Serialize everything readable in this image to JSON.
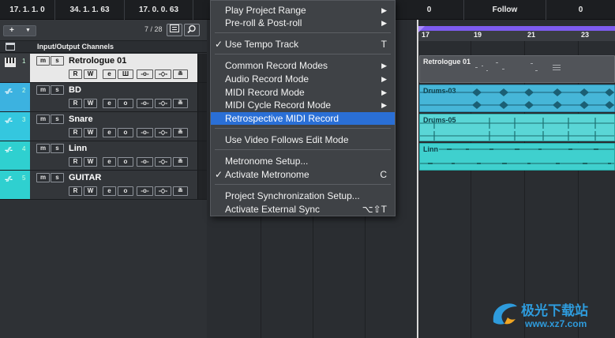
{
  "transport": {
    "cells": [
      "17. 1. 1.   0",
      "34. 1. 1. 63",
      "17. 0. 0. 63",
      "0",
      "Follow",
      "0"
    ]
  },
  "tracklist": {
    "add_label": "+",
    "count": "7 / 28",
    "io_label": "Input/Output Channels",
    "tracks": [
      {
        "num": "1",
        "name": "Retrologue 01",
        "color": "#e8e8e8"
      },
      {
        "num": "2",
        "name": "BD",
        "color": "#3cb2e0"
      },
      {
        "num": "3",
        "name": "Snare",
        "color": "#34c7df"
      },
      {
        "num": "4",
        "name": "Linn",
        "color": "#2fd0d0"
      },
      {
        "num": "5",
        "name": "GUITAR",
        "color": "#2fd0d0"
      }
    ],
    "buttons": {
      "m": "m",
      "s": "s",
      "r": "R",
      "w": "W",
      "e": "e"
    }
  },
  "ruler": {
    "marks": [
      "17",
      "19",
      "21",
      "23"
    ]
  },
  "events": {
    "retrologue": "Retrologue 01",
    "drums03": "Drums-03",
    "drums05": "Drums-05",
    "linn": "Linn"
  },
  "menu": {
    "items": [
      {
        "label": "Play Project Range"
      },
      {
        "label": "Pre-roll & Post-roll"
      },
      {
        "label": "Use Tempo Track",
        "check": "✓",
        "shortcut": "T"
      },
      {
        "label": "Common Record Modes"
      },
      {
        "label": "Audio Record Mode"
      },
      {
        "label": "MIDI Record Mode"
      },
      {
        "label": "MIDI Cycle Record Mode"
      },
      {
        "label": "Retrospective MIDI Record"
      },
      {
        "label": "Use Video Follows Edit Mode"
      },
      {
        "label": "Metronome Setup..."
      },
      {
        "label": "Activate Metronome",
        "check": "✓",
        "shortcut": "C"
      },
      {
        "label": "Project Synchronization Setup..."
      },
      {
        "label": "Activate External Sync",
        "shortcut": "⌥⇧T"
      }
    ],
    "highlight_color": "#2a6fd6"
  },
  "watermark": {
    "cn": "极光下载站",
    "url": "www.xz7.com"
  }
}
